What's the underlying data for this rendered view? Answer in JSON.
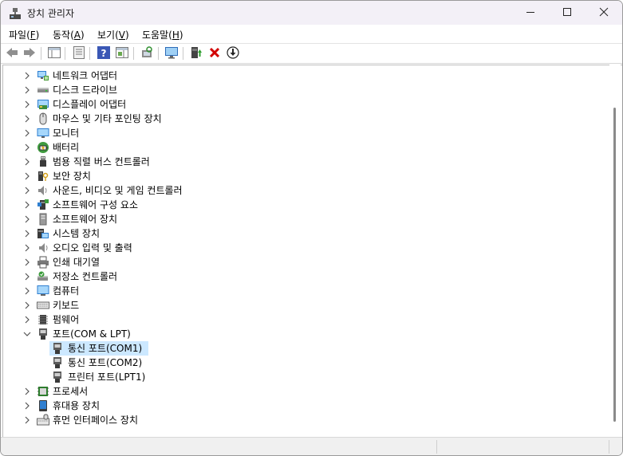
{
  "window": {
    "title": "장치 관리자"
  },
  "menu": [
    {
      "label": "파일(F)",
      "underline": "F"
    },
    {
      "label": "동작(A)",
      "underline": "A"
    },
    {
      "label": "보기(V)",
      "underline": "V"
    },
    {
      "label": "도움말(H)",
      "underline": "H"
    }
  ],
  "toolbar": {
    "icons": [
      "back-icon",
      "forward-icon",
      "properties-grid-icon",
      "view-icon",
      "help-icon",
      "details-icon",
      "scan-hardware-icon",
      "monitor-icon",
      "enable-device-icon",
      "uninstall-icon",
      "update-driver-icon"
    ]
  },
  "tree": {
    "categories": [
      {
        "label": "네트워크 어댑터",
        "icon": "network-adapter-icon",
        "expanded": false
      },
      {
        "label": "디스크 드라이브",
        "icon": "disk-drive-icon",
        "expanded": false
      },
      {
        "label": "디스플레이 어댑터",
        "icon": "display-adapter-icon",
        "expanded": false
      },
      {
        "label": "마우스 및 기타 포인팅 장치",
        "icon": "mouse-icon",
        "expanded": false
      },
      {
        "label": "모니터",
        "icon": "monitor-icon",
        "expanded": false
      },
      {
        "label": "배터리",
        "icon": "battery-icon",
        "expanded": false
      },
      {
        "label": "범용 직렬 버스 컨트롤러",
        "icon": "usb-controller-icon",
        "expanded": false
      },
      {
        "label": "보안 장치",
        "icon": "security-device-icon",
        "expanded": false
      },
      {
        "label": "사운드, 비디오 및 게임 컨트롤러",
        "icon": "sound-icon",
        "expanded": false
      },
      {
        "label": "소프트웨어 구성 요소",
        "icon": "software-component-icon",
        "expanded": false
      },
      {
        "label": "소프트웨어 장치",
        "icon": "software-device-icon",
        "expanded": false
      },
      {
        "label": "시스템 장치",
        "icon": "system-device-icon",
        "expanded": false
      },
      {
        "label": "오디오 입력 및 출력",
        "icon": "audio-io-icon",
        "expanded": false
      },
      {
        "label": "인쇄 대기열",
        "icon": "printer-icon",
        "expanded": false
      },
      {
        "label": "저장소 컨트롤러",
        "icon": "storage-controller-icon",
        "expanded": false
      },
      {
        "label": "컴퓨터",
        "icon": "computer-icon",
        "expanded": false
      },
      {
        "label": "키보드",
        "icon": "keyboard-icon",
        "expanded": false
      },
      {
        "label": "펌웨어",
        "icon": "firmware-icon",
        "expanded": false
      },
      {
        "label": "포트(COM & LPT)",
        "icon": "port-icon",
        "expanded": true,
        "children": [
          {
            "label": "통신 포트(COM1)",
            "icon": "port-icon",
            "selected": true
          },
          {
            "label": "통신 포트(COM2)",
            "icon": "port-icon",
            "selected": false
          },
          {
            "label": "프린터 포트(LPT1)",
            "icon": "port-icon",
            "selected": false
          }
        ]
      },
      {
        "label": "프로세서",
        "icon": "processor-icon",
        "expanded": false
      },
      {
        "label": "휴대용 장치",
        "icon": "portable-device-icon",
        "expanded": false
      },
      {
        "label": "휴먼 인터페이스 장치",
        "icon": "hid-icon",
        "expanded": false
      }
    ]
  },
  "colors": {
    "selection": "#cce8ff",
    "titlebar": "#f3f0f7",
    "uninstall_red": "#d20000"
  }
}
